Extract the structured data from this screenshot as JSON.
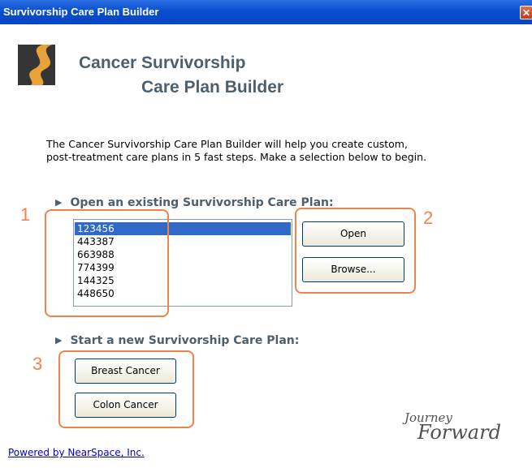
{
  "window": {
    "title": "Survivorship Care Plan Builder",
    "close_glyph": "✕"
  },
  "header": {
    "logo_icon": "winding-road-logo",
    "title_line1": "Cancer Survivorship",
    "title_line2": "Care Plan Builder"
  },
  "intro": {
    "line1": "The Cancer Survivorship Care Plan Builder will help you create custom,",
    "line2": "post-treatment care plans in 5 fast steps.  Make a selection below to begin."
  },
  "open_section": {
    "heading": "Open an existing Survivorship Care Plan:",
    "items": [
      "123456",
      "443387",
      "663988",
      "774399",
      "144325",
      "448650"
    ],
    "selected_index": 0,
    "open_label": "Open",
    "browse_label": "Browse..."
  },
  "new_section": {
    "heading": "Start a new Survivorship Care Plan:",
    "breast_label": "Breast Cancer",
    "colon_label": "Colon Cancer"
  },
  "annotations": [
    "1",
    "2",
    "3"
  ],
  "brand": {
    "line1": "Journey",
    "line2": "Forward"
  },
  "footer": {
    "powered_by": "Powered by NearSpace, Inc."
  },
  "colors": {
    "titlebar": "#0a4fcf",
    "heading": "#4d5f6d",
    "selection": "#316ac5",
    "annotation": "#f0834a",
    "link": "#0000cc"
  }
}
